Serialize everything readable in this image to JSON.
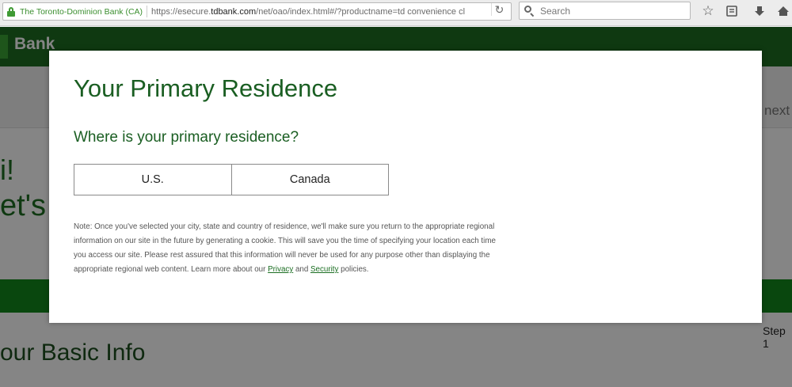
{
  "browser": {
    "identity": "The Toronto-Dominion Bank (CA)",
    "url_prefix": "https://esecure.",
    "url_host": "tdbank.com",
    "url_path": "/net/oao/index.html#/?productname=td convenience cl",
    "search_placeholder": "Search"
  },
  "background_page": {
    "logo_text": "Bank",
    "next_text": "next",
    "greeting_line1": "i!",
    "greeting_line2": "et's",
    "step_text": "Step 1",
    "section_heading": "our Basic Info"
  },
  "modal": {
    "title": "Your Primary Residence",
    "question": "Where is your primary residence?",
    "options": [
      "U.S.",
      "Canada"
    ],
    "note_text": "Note: Once you've selected your city, state and country of residence, we'll make sure you return to the appropriate regional information on our site in the future by generating a cookie. This will save you the time of specifying your location each time you access our site. Please rest assured that this information will never be used for any purpose other than displaying the appropriate regional web content. Learn more about our ",
    "privacy_link": "Privacy",
    "and_text": " and ",
    "security_link": "Security",
    "policies_text": " policies."
  },
  "colors": {
    "brand_green": "#1d6e22",
    "heading_green": "#1a5e22",
    "band_green": "#13891c",
    "secure_green": "#3a8e2e"
  }
}
